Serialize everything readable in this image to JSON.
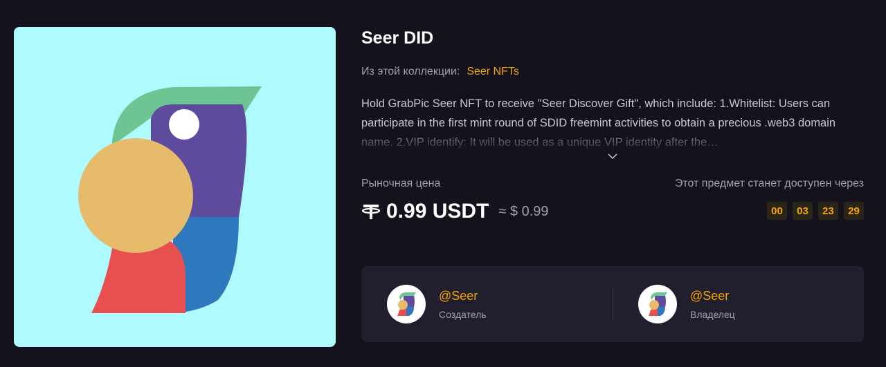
{
  "item": {
    "title": "Seer DID",
    "collection_label": "Из этой коллекции:",
    "collection_name": "Seer NFTs",
    "description": "Hold GrabPic Seer NFT to receive \"Seer Discover Gift\", which include: 1.Whitelist: Users can participate in the first mint round of SDID freemint activities to obtain a precious .web3 domain name. 2.VIP identify: It will be used as a unique VIP identity after the…"
  },
  "price": {
    "label": "Рыночная цена",
    "currency_icon": "tether-icon",
    "value": "0.99 USDT",
    "approx": "≈ $ 0.99"
  },
  "availability": {
    "label": "Этот предмет станет доступен через",
    "countdown": [
      "00",
      "03",
      "23",
      "29"
    ]
  },
  "creator": {
    "name": "@Seer",
    "role": "Создатель"
  },
  "owner": {
    "name": "@Seer",
    "role": "Владелец"
  },
  "colors": {
    "accent": "#f7a600",
    "background": "#13121d",
    "card": "#211f2d",
    "image_bg": "#aefaff"
  }
}
